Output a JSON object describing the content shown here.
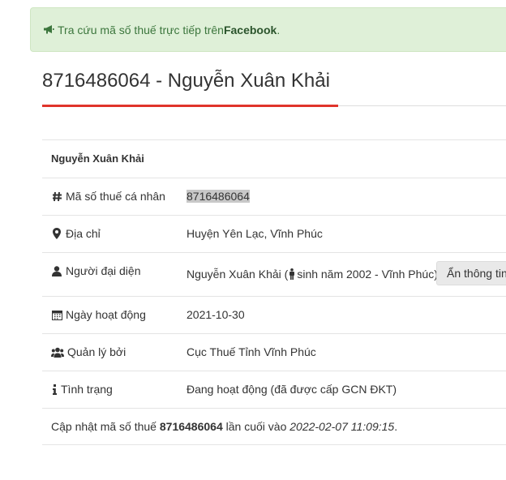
{
  "alert": {
    "text": "Tra cứu mã số thuế trực tiếp trên ",
    "link_label": "Facebook",
    "suffix": ".",
    "icon": "bullhorn-icon",
    "color": "#3c763d",
    "background": "#dff0d8"
  },
  "header": {
    "title": "8716486064 - Nguyễn Xuân Khải",
    "accent_color": "#e0342b"
  },
  "table": {
    "heading": "Nguyễn Xuân Khải",
    "rows": [
      {
        "icon": "hash-icon",
        "label": "Mã số thuế cá nhân",
        "value": "8716486064"
      },
      {
        "icon": "map-marker-icon",
        "label": "Địa chỉ",
        "value": "Huyện Yên Lạc, Vĩnh Phúc"
      },
      {
        "icon": "user-icon",
        "label": "Người đại diện",
        "value_name": "Nguyễn Xuân Khải",
        "paren_open": " (",
        "value_birth": "sinh năm 2002 - Vĩnh Phúc)",
        "button_label": "Ẩn thông tin"
      },
      {
        "icon": "calendar-icon",
        "label": "Ngày hoạt động",
        "value": "2021-10-30"
      },
      {
        "icon": "users-icon",
        "label": "Quản lý bởi",
        "value": "Cục Thuế Tỉnh Vĩnh Phúc"
      },
      {
        "icon": "info-icon",
        "label": "Tình trạng",
        "value": "Đang hoạt động (đã được cấp GCN ĐKT)"
      }
    ]
  },
  "footer": {
    "prefix": "Cập nhật mã số thuế ",
    "tax_code": "8716486064",
    "middle": " lần cuối vào ",
    "timestamp": "2022-02-07 11:09:15",
    "suffix": "."
  }
}
